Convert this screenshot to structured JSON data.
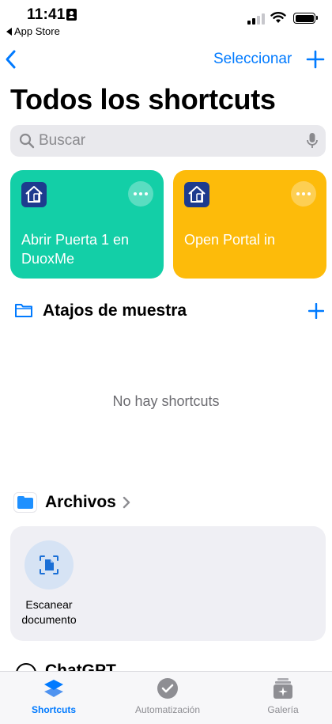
{
  "status_bar": {
    "time": "11:41",
    "back_app": "App Store"
  },
  "nav": {
    "select_label": "Seleccionar"
  },
  "page_title": "Todos los shortcuts",
  "search": {
    "placeholder": "Buscar"
  },
  "shortcuts": [
    {
      "label": "Abrir Puerta 1 en DuoxMe",
      "color": "#13cfa7"
    },
    {
      "label": "Open Portal in",
      "color": "#fdbb0a"
    }
  ],
  "sample_section": {
    "title": "Atajos de muestra",
    "empty_text": "No hay shortcuts"
  },
  "files_section": {
    "title": "Archivos",
    "actions": [
      {
        "label": "Escanear documento",
        "icon": "document-scan-icon"
      }
    ]
  },
  "chatgpt_section": {
    "title": "ChatGPT"
  },
  "tabbar": {
    "tabs": [
      {
        "label": "Shortcuts",
        "icon": "layers-icon",
        "active": true
      },
      {
        "label": "Automatización",
        "icon": "checkmark-clock-icon",
        "active": false
      },
      {
        "label": "Galería",
        "icon": "gallery-icon",
        "active": false
      }
    ]
  },
  "colors": {
    "accent": "#007aff",
    "teal_card": "#13cfa7",
    "yellow_card": "#fdbb0a",
    "app_icon": "#1d3b8e"
  }
}
